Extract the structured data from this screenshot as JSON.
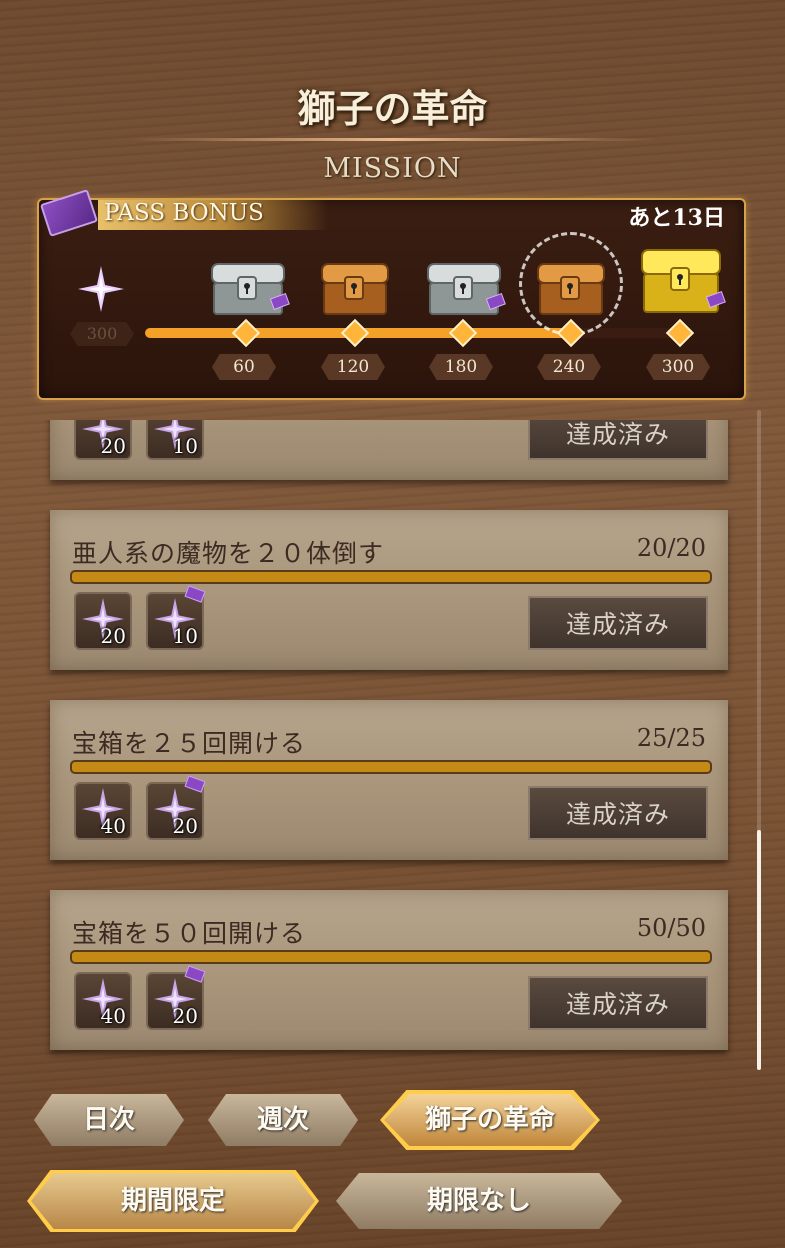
{
  "header": {
    "title": "獅子の革命",
    "subtitle": "MISSION"
  },
  "pass_bonus": {
    "label": "PASS BONUS",
    "remaining": "あと13日",
    "points": "300",
    "progress_fraction": 0.8,
    "milestones": [
      {
        "value": "60",
        "chest": "silver"
      },
      {
        "value": "120",
        "chest": "bronze"
      },
      {
        "value": "180",
        "chest": "silver"
      },
      {
        "value": "240",
        "chest": "bronze"
      },
      {
        "value": "300",
        "chest": "gold"
      }
    ]
  },
  "missions": [
    {
      "title": "",
      "count": "",
      "rewards": [
        "20",
        "10"
      ],
      "button": "達成済み"
    },
    {
      "title": "亜人系の魔物を２０体倒す",
      "count": "20/20",
      "rewards": [
        "20",
        "10"
      ],
      "button": "達成済み"
    },
    {
      "title": "宝箱を２５回開ける",
      "count": "25/25",
      "rewards": [
        "40",
        "20"
      ],
      "button": "達成済み"
    },
    {
      "title": "宝箱を５０回開ける",
      "count": "50/50",
      "rewards": [
        "40",
        "20"
      ],
      "button": "達成済み"
    }
  ],
  "tabs": [
    "日次",
    "週次",
    "獅子の革命"
  ],
  "active_tab": "獅子の革命",
  "filters": [
    "期間限定",
    "期限なし"
  ],
  "active_filter": "期間限定",
  "colors": {
    "accent_gold": "#d8a24a",
    "progress_orange": "#f4a128",
    "card_bar": "#c48a16"
  }
}
